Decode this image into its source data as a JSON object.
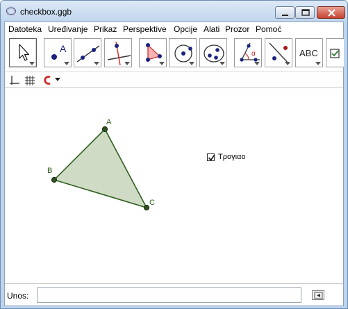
{
  "window": {
    "title": "checkbox.ggb",
    "controls": [
      "minimize",
      "maximize",
      "close"
    ]
  },
  "menu": {
    "items": [
      {
        "label": "Datoteka"
      },
      {
        "label": "Uređivanje"
      },
      {
        "label": "Prikaz"
      },
      {
        "label": "Perspektive"
      },
      {
        "label": "Opcije"
      },
      {
        "label": "Alati"
      },
      {
        "label": "Prozor"
      },
      {
        "label": "Pomoć"
      }
    ]
  },
  "toolbar": {
    "tools": [
      {
        "name": "move-tool-icon",
        "selected": true
      },
      {
        "name": "point-tool-icon"
      },
      {
        "name": "line-tool-icon"
      },
      {
        "name": "perpendicular-line-tool-icon"
      },
      {
        "name": "polygon-tool-icon"
      },
      {
        "name": "circle-tool-icon"
      },
      {
        "name": "conic-tool-icon"
      },
      {
        "name": "angle-tool-icon"
      },
      {
        "name": "reflect-tool-icon"
      },
      {
        "name": "text-tool-icon",
        "label": "ABC"
      },
      {
        "name": "checkbox-tool-icon"
      }
    ]
  },
  "stylebar": {
    "icons": [
      "axes-icon",
      "grid-icon",
      "point-capture-icon",
      "dropdown-arrow-icon"
    ]
  },
  "graphics": {
    "points": [
      {
        "name": "A"
      },
      {
        "name": "B"
      },
      {
        "name": "C"
      }
    ],
    "polygon_fill": "#cdd9c1",
    "polygon_stroke": "#2f5f1f",
    "checkbox": {
      "label": "Τρογιαο",
      "checked": true
    }
  },
  "inputbar": {
    "label": "Unos:",
    "value": "",
    "placeholder": ""
  },
  "colors": {
    "window_frame": "#bcd4ee",
    "close_button": "#c7432f",
    "accent_point": "#1a237e"
  }
}
